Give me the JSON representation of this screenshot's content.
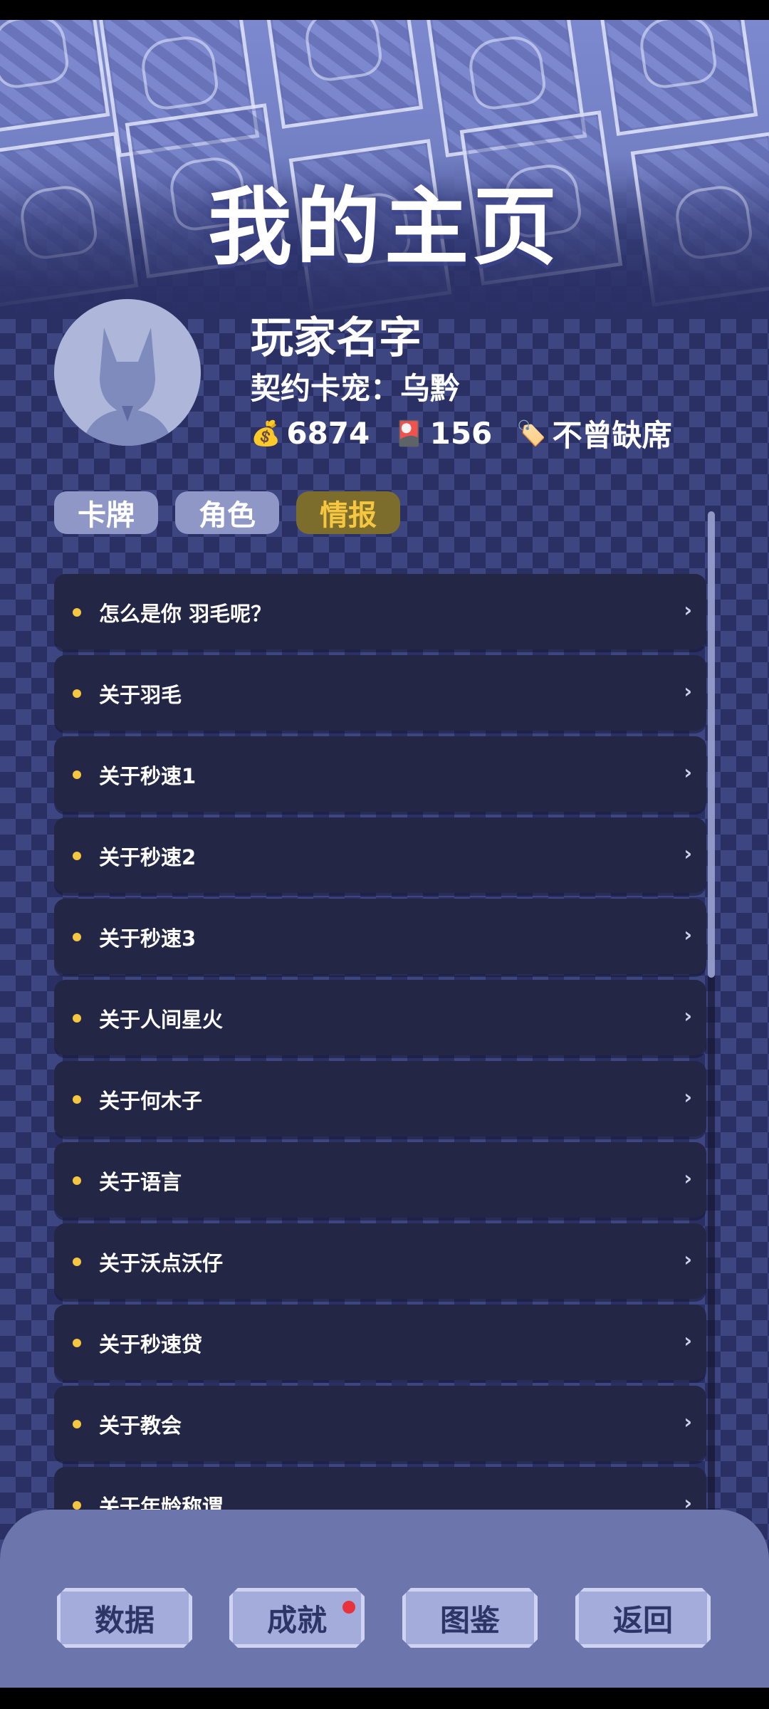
{
  "header": {
    "title": "我的主页"
  },
  "profile": {
    "player_name": "玩家名字",
    "contract_pet": "契约卡宠：乌黔",
    "stats": [
      {
        "icon": "money-bag-icon",
        "glyph": "💰",
        "value": "6874"
      },
      {
        "icon": "card-icon",
        "glyph": "🎴",
        "value": "156"
      },
      {
        "icon": "tag-icon",
        "glyph": "🏷️",
        "value": "不曾缺席"
      }
    ]
  },
  "tabs": [
    {
      "label": "卡牌",
      "active": false
    },
    {
      "label": "角色",
      "active": false
    },
    {
      "label": "情报",
      "active": true
    }
  ],
  "intel_list": [
    "怎么是你 羽毛呢？",
    "关于羽毛",
    "关于秒速1",
    "关于秒速2",
    "关于秒速3",
    "关于人间星火",
    "关于何木子",
    "关于语言",
    "关于沃点沃仔",
    "关于秒速贷",
    "关于教会",
    "关于年龄称谓"
  ],
  "bottom_nav": [
    {
      "label": "数据",
      "badge": false
    },
    {
      "label": "成就",
      "badge": true
    },
    {
      "label": "图鉴",
      "badge": false
    },
    {
      "label": "返回",
      "badge": false
    }
  ],
  "colors": {
    "accent": "#f5c640",
    "active_tab_bg": "#7d6d2c",
    "tab_bg": "#8e97c5",
    "list_item_bg": "#242645",
    "bottom_bar_bg": "#6c76ad",
    "badge": "#e8323c"
  }
}
